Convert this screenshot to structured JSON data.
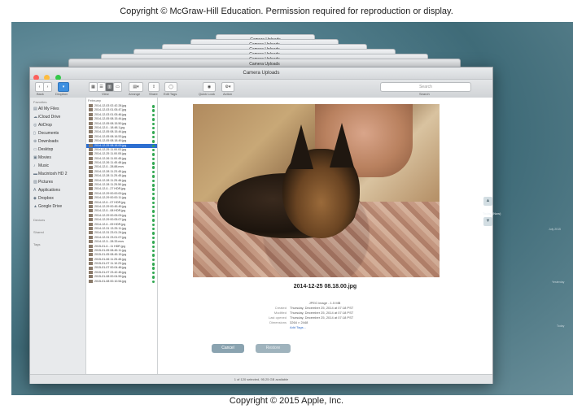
{
  "copyright_top": "Copyright © McGraw-Hill Education. Permission required for reproduction or display.",
  "copyright_bottom": "Copyright © 2015 Apple, Inc.",
  "stack_title": "Camera Uploads",
  "window": {
    "title": "Camera Uploads",
    "toolbar": {
      "back_label": "Back",
      "dropbox_label": "Dropbox",
      "view_label": "View",
      "arrange_label": "Arrange",
      "share_label": "Share",
      "edit_tags_label": "Edit Tags",
      "quick_look_label": "Quick Look",
      "action_label": "Action",
      "search_placeholder": "Search",
      "search_label": "Search"
    },
    "sidebar": {
      "favorites_header": "Favorites",
      "items": [
        {
          "icon": "all-files-icon",
          "label": "All My Files"
        },
        {
          "icon": "cloud-icon",
          "label": "iCloud Drive"
        },
        {
          "icon": "airdrop-icon",
          "label": "AirDrop"
        },
        {
          "icon": "documents-icon",
          "label": "Documents"
        },
        {
          "icon": "downloads-icon",
          "label": "Downloads"
        },
        {
          "icon": "desktop-icon",
          "label": "Desktop"
        },
        {
          "icon": "movies-icon",
          "label": "Movies"
        },
        {
          "icon": "music-icon",
          "label": "Music"
        },
        {
          "icon": "disk-icon",
          "label": "Macintosh HD 2"
        },
        {
          "icon": "pictures-icon",
          "label": "Pictures"
        },
        {
          "icon": "applications-icon",
          "label": "Applications"
        },
        {
          "icon": "dropbox-icon",
          "label": "Dropbox"
        },
        {
          "icon": "google-drive-icon",
          "label": "Google Drive"
        }
      ],
      "devices_header": "Devices",
      "shared_header": "Shared",
      "tags_header": "Tags"
    },
    "list": {
      "header": "February",
      "rows": [
        "2014-12-03 02.42.28.jpg",
        "2014-12-03 01.05.47.jpg",
        "2014-12-03 01.05.46.jpg",
        "2014-12-05 08.15.44.jpg",
        "2014-12-05 08.15.50.jpg",
        "2014-12-0...18.48.1.jpg",
        "2014-12-05 08.15.44.jpg",
        "2014-12-05 08.16.53.jpg",
        "2014-12-05 08.18.49.jpg",
        "2014-12-25 08.18.00.jpg",
        "2014-12-25 11.00.03.jpg",
        "2014-12-25 11.00.05.jpg",
        "2014-12-26 11.00.45.jpg",
        "2014-12-26 11.45.48.jpg",
        "2014-12-0...28.88.mov",
        "2014-12-28 11.23.45.jpg",
        "2014-12-28 11.25.45.jpg",
        "2014-12-28 11.25.46.jpg",
        "2014-12-28 11.25.50.jpg",
        "2014-12-0...27 HDR.jpg",
        "2014-12-29 00.00.00.jpg",
        "2014-12-29 00.00.11.jpg",
        "2014-12-0...07 HDR.jpg",
        "2014-12-29 00.45.45.jpg",
        "2014-12-0...08 HDR.jpg",
        "2014-12-29 00.05.09.jpg",
        "2014-12-29 00.05.07.jpg",
        "2014-12-0...09 HDR.jpg",
        "2014-12-31 13.25.11.jpg",
        "2014-12-31 23.01.24.jpg",
        "2014-12-31 23.01.07.jpg",
        "2014-12-3...28.33.mov",
        "2015-01-0...11 HDR.jpg",
        "2015-01-05 08.45.11.jpg",
        "2015-01-05 08.45.15.jpg",
        "2015-01-06 11.25.45.jpg",
        "2015-01-07 11.10.23.jpg",
        "2015-01-07 00.04.48.jpg",
        "2015-01-07 23.42.45.jpg",
        "2015-01-08 00.04.59.jpg",
        "2015-01-08 00.10.54.jpg"
      ],
      "selected_index": 9
    },
    "preview": {
      "filename": "2014-12-25 08.18.00.jpg",
      "kind": "JPEG image - 1.5 MB",
      "meta": [
        {
          "key": "Created",
          "value": "Thursday, December 25, 2014 at 07:18 PST"
        },
        {
          "key": "Modified",
          "value": "Thursday, December 25, 2014 at 07:18 PST"
        },
        {
          "key": "Last opened",
          "value": "Thursday, December 25, 2014 at 07:18 PST"
        },
        {
          "key": "Dimensions",
          "value": "3264 × 2448"
        }
      ],
      "add_tags": "Add Tags..."
    },
    "status": "1 of 120 selected, 95.25 GB available"
  },
  "buttons": {
    "cancel": "Cancel",
    "restore": "Restore"
  },
  "timeline": {
    "today_label": "Today (Now)",
    "labels": [
      "July 2015",
      "Yesterday",
      "Today"
    ]
  }
}
